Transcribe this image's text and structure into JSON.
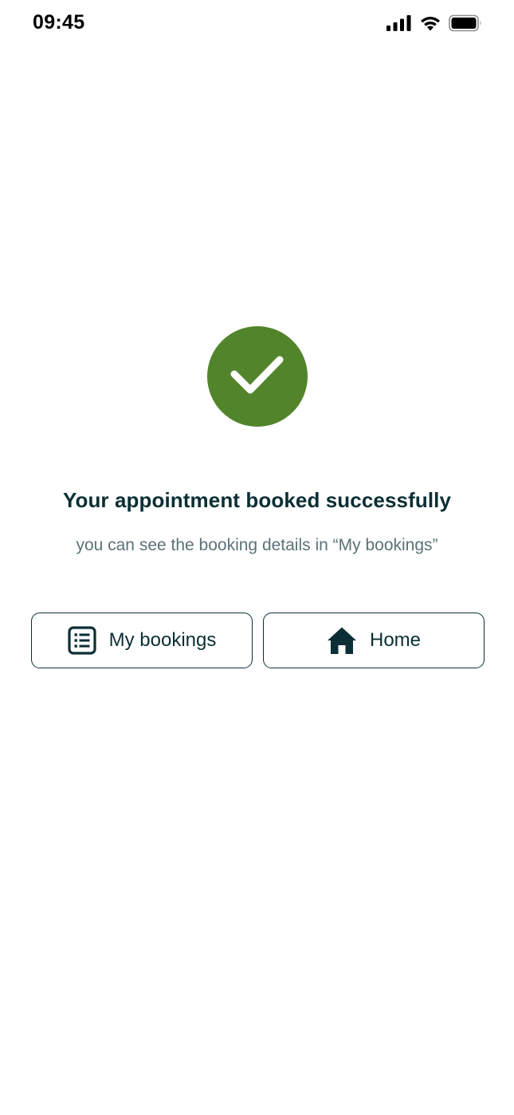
{
  "status_bar": {
    "time": "09:45",
    "icons": [
      "cellular-signal-icon",
      "wifi-icon",
      "battery-icon"
    ]
  },
  "success": {
    "icon": "check-icon",
    "color": "#52852b",
    "title": "Your appointment booked successfully",
    "subtitle": "you can see the booking details in “My bookings”"
  },
  "actions": {
    "my_bookings": {
      "label": "My bookings",
      "icon": "list-icon"
    },
    "home": {
      "label": "Home",
      "icon": "home-icon"
    }
  },
  "colors": {
    "text_primary": "#0b2f34",
    "text_secondary": "#5b7276",
    "accent": "#52852b",
    "background": "#ffffff"
  }
}
